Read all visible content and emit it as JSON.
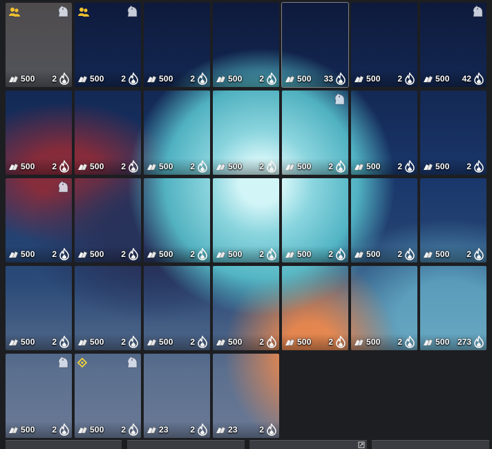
{
  "tiles": [
    {
      "count": "500",
      "level": "2",
      "gold": true,
      "people_icon": true,
      "horse_badge": true
    },
    {
      "count": "500",
      "level": "2",
      "people_icon": true,
      "horse_badge": true
    },
    {
      "count": "500",
      "level": "2"
    },
    {
      "count": "500",
      "level": "2"
    },
    {
      "count": "500",
      "level": "33",
      "selected": true
    },
    {
      "count": "500",
      "level": "2"
    },
    {
      "count": "500",
      "level": "42",
      "horse_badge": true
    },
    {
      "count": "500",
      "level": "2"
    },
    {
      "count": "500",
      "level": "2"
    },
    {
      "count": "500",
      "level": "2"
    },
    {
      "count": "500",
      "level": "2"
    },
    {
      "count": "500",
      "level": "2",
      "horse_badge": true
    },
    {
      "count": "500",
      "level": "2"
    },
    {
      "count": "500",
      "level": "2"
    },
    {
      "count": "500",
      "level": "2",
      "horse_badge": true
    },
    {
      "count": "500",
      "level": "2"
    },
    {
      "count": "500",
      "level": "2"
    },
    {
      "count": "500",
      "level": "2"
    },
    {
      "count": "500",
      "level": "2"
    },
    {
      "count": "500",
      "level": "2"
    },
    {
      "count": "500",
      "level": "2"
    },
    {
      "count": "500",
      "level": "2"
    },
    {
      "count": "500",
      "level": "2"
    },
    {
      "count": "500",
      "level": "2"
    },
    {
      "count": "500",
      "level": "2"
    },
    {
      "count": "500",
      "level": "2"
    },
    {
      "count": "500",
      "level": "2"
    },
    {
      "count": "500",
      "level": "273"
    },
    {
      "count": "500",
      "level": "2",
      "horse_badge": true
    },
    {
      "count": "500",
      "level": "2",
      "target_icon": true,
      "horse_badge": true
    },
    {
      "count": "23",
      "level": "2"
    },
    {
      "count": "23",
      "level": "2"
    }
  ],
  "colors": {
    "background": "#1d1e21",
    "people_icon": "#f2c12e",
    "target_icon": "#f2d23a"
  }
}
